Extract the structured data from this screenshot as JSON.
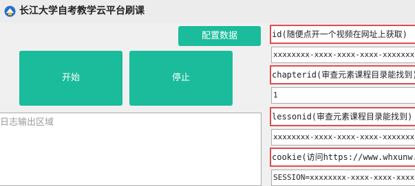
{
  "window": {
    "title": "长江大学自考教学云平台刷课",
    "logo_icon": "school-logo-icon"
  },
  "buttons": {
    "config_label": "配置数据",
    "start_label": "开始",
    "stop_label": "停止"
  },
  "log": {
    "placeholder": "日志输出区域"
  },
  "fields": [
    {
      "label": "id(随便点开一个视频在网址上获取)",
      "value": "xxxxxxxx-xxxx-xxxx-xxxx-xxxxxxxxxxxx"
    },
    {
      "label": "chapterid(审查元素课程目录能找到)",
      "value": "1"
    },
    {
      "label": "lessonid(审查元素课程目录能找到)",
      "value": "xxxxxxxx-xxxx-xxxx-xxxx-xxxxxxxxxxxx"
    },
    {
      "label": "cookie(访问https://www.whxunw.com",
      "value": "SESSION=xxxxxxxx-xxxx-xxxx-xxxx-xxxxxxxxxxxx"
    }
  ],
  "colors": {
    "accent": "#1abc9c",
    "label_border": "#e14a4a"
  }
}
